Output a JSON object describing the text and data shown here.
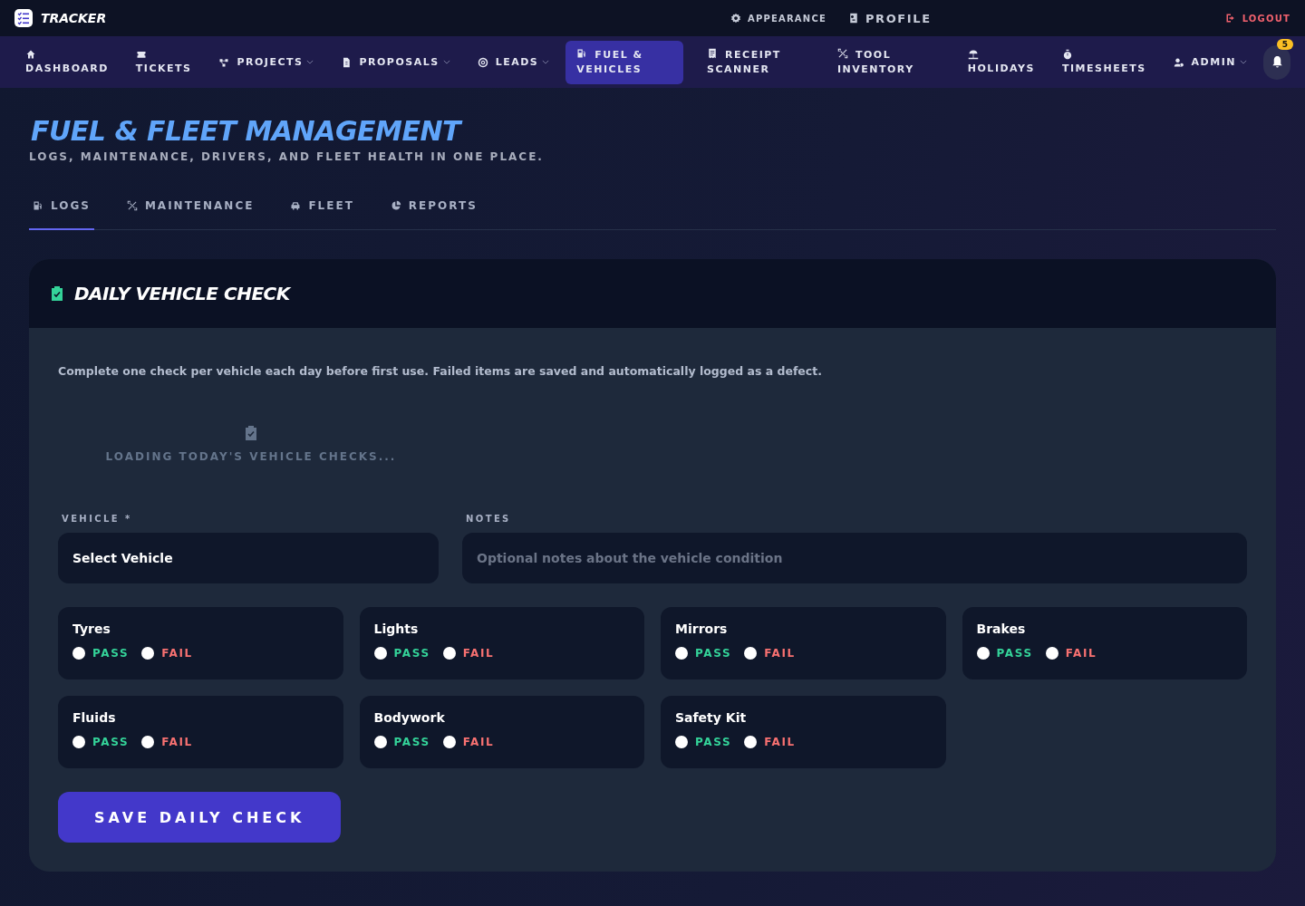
{
  "brand": "TRACKER",
  "top_links": [
    {
      "kind": "appearance",
      "label": "APPEARANCE"
    },
    {
      "kind": "profile",
      "label": "PROFILE"
    },
    {
      "kind": "logout",
      "label": "LOGOUT"
    }
  ],
  "nav": [
    {
      "kind": "stacked",
      "label": "DASHBOARD",
      "selected": false
    },
    {
      "kind": "stacked",
      "label": "TICKETS",
      "selected": false
    },
    {
      "kind": "dropdown",
      "label": "PROJECTS",
      "selected": false
    },
    {
      "kind": "dropdown",
      "label": "PROPOSALS",
      "selected": false
    },
    {
      "kind": "dropdown",
      "label": "LEADS",
      "selected": false
    },
    {
      "kind": "wrapped",
      "label": "FUEL & VEHICLES",
      "selected": true
    },
    {
      "kind": "wrapped",
      "label": "RECEIPT SCANNER",
      "selected": false
    },
    {
      "kind": "wrapped",
      "label": "TOOL INVENTORY",
      "selected": false
    },
    {
      "kind": "stacked",
      "label": "HOLIDAYS",
      "selected": false
    },
    {
      "kind": "stacked",
      "label": "TIMESHEETS",
      "selected": false
    },
    {
      "kind": "dropdown",
      "label": "ADMIN",
      "selected": false
    }
  ],
  "notifications": {
    "count": "5"
  },
  "page": {
    "title": "FUEL & FLEET MANAGEMENT",
    "subtitle": "LOGS, MAINTENANCE, DRIVERS, AND FLEET HEALTH IN ONE PLACE."
  },
  "tabs": [
    {
      "label": "LOGS",
      "selected": true
    },
    {
      "label": "MAINTENANCE",
      "selected": false
    },
    {
      "label": "FLEET",
      "selected": false
    },
    {
      "label": "REPORTS",
      "selected": false
    }
  ],
  "card": {
    "title": "DAILY VEHICLE CHECK",
    "intro": "Complete one check per vehicle each day before first use. Failed items are saved and automatically logged as a defect.",
    "loading": "LOADING TODAY'S VEHICLE CHECKS...",
    "vehicle": {
      "label": "VEHICLE *",
      "value": "Select Vehicle"
    },
    "notes": {
      "label": "NOTES",
      "placeholder": "Optional notes about the vehicle condition"
    },
    "checks": [
      {
        "name": "Tyres",
        "options": [
          {
            "kind": "pass",
            "label": "PASS",
            "selected": false
          },
          {
            "kind": "fail",
            "label": "FAIL",
            "selected": false
          }
        ]
      },
      {
        "name": "Lights",
        "options": [
          {
            "kind": "pass",
            "label": "PASS",
            "selected": false
          },
          {
            "kind": "fail",
            "label": "FAIL",
            "selected": false
          }
        ]
      },
      {
        "name": "Mirrors",
        "options": [
          {
            "kind": "pass",
            "label": "PASS",
            "selected": false
          },
          {
            "kind": "fail",
            "label": "FAIL",
            "selected": false
          }
        ]
      },
      {
        "name": "Brakes",
        "options": [
          {
            "kind": "pass",
            "label": "PASS",
            "selected": false
          },
          {
            "kind": "fail",
            "label": "FAIL",
            "selected": false
          }
        ]
      },
      {
        "name": "Fluids",
        "options": [
          {
            "kind": "pass",
            "label": "PASS",
            "selected": false
          },
          {
            "kind": "fail",
            "label": "FAIL",
            "selected": false
          }
        ]
      },
      {
        "name": "Bodywork",
        "options": [
          {
            "kind": "pass",
            "label": "PASS",
            "selected": false
          },
          {
            "kind": "fail",
            "label": "FAIL",
            "selected": false
          }
        ]
      },
      {
        "name": "Safety Kit",
        "options": [
          {
            "kind": "pass",
            "label": "PASS",
            "selected": false
          },
          {
            "kind": "fail",
            "label": "FAIL",
            "selected": false
          }
        ]
      }
    ],
    "save": "SAVE DAILY CHECK"
  }
}
